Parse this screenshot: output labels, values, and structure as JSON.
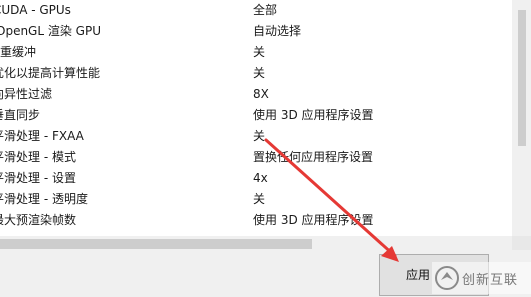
{
  "settings": [
    {
      "feature": "CUDA - GPUs",
      "value": "全部"
    },
    {
      "feature": "OpenGL 渲染 GPU",
      "value": "自动选择"
    },
    {
      "feature": "三重缓冲",
      "value": "关"
    },
    {
      "feature": "优化以提高计算性能",
      "value": "关"
    },
    {
      "feature": "各向异性过滤",
      "value": "8X"
    },
    {
      "feature": "垂直同步",
      "value": "使用 3D 应用程序设置"
    },
    {
      "feature": "平滑处理 - FXAA",
      "value": "关"
    },
    {
      "feature": "平滑处理 - 模式",
      "value": "置换任何应用程序设置"
    },
    {
      "feature": "平滑处理 - 设置",
      "value": "4x"
    },
    {
      "feature": "平滑处理 - 透明度",
      "value": "关"
    },
    {
      "feature": "最大预渲染帧数",
      "value": "使用 3D 应用程序设置"
    }
  ],
  "buttons": {
    "apply_label": "应用"
  },
  "watermark": {
    "text": "创新互联"
  },
  "colors": {
    "annotation_arrow": "#e53935",
    "panel_bg": "#ffffff",
    "window_bg": "#f0f0f0"
  }
}
